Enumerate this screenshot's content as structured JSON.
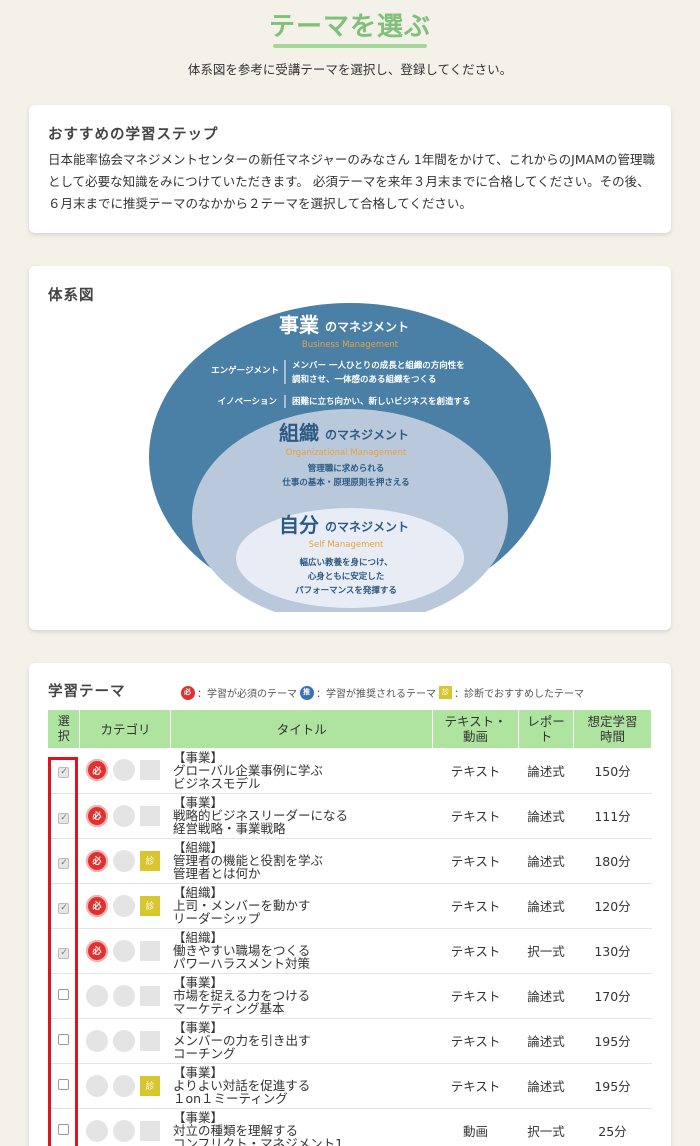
{
  "header": {
    "title": "テーマを選ぶ",
    "subtitle": "体系図を参考に受講テーマを選択し、登録してください。"
  },
  "recommend": {
    "heading": "おすすめの学習ステップ",
    "body": "日本能率協会マネジメントセンターの新任マネジャーのみなさん 1年間をかけて、これからのJMAMの管理職として必要な知識をみにつけていただきます。 必須テーマを来年３月末までに合格してください。その後、６月末までに推奨テーマのなかから２テーマを選択して合格してください。"
  },
  "system": {
    "heading": "体系図",
    "outer": {
      "title_big": "事業",
      "title_small": "のマネジメント",
      "english": "Business Management",
      "rows": [
        {
          "label": "エンゲージメント",
          "text1": "メンバー 一人ひとりの成長と組織の方向性を",
          "text2": "調和させ、一体感のある組織をつくる"
        },
        {
          "label": "イノベーション",
          "text1": "困難に立ち向かい、新しいビジネスを創造する",
          "text2": ""
        }
      ]
    },
    "middle": {
      "title_big": "組織",
      "title_small": "のマネジメント",
      "english": "Organizational Management",
      "line1": "管理職に求められる",
      "line2": "仕事の基本・原理原則を押さえる"
    },
    "inner": {
      "title_big": "自分",
      "title_small": "のマネジメント",
      "english": "Self Management",
      "line1": "幅広い教養を身につけ、",
      "line2": "心身ともに安定した",
      "line3": "パフォーマンスを発揮する"
    }
  },
  "themes": {
    "heading": "学習テーマ",
    "legend": {
      "required_mark": "必",
      "required_text": "：学習が必須のテーマ",
      "recommended_mark": "推",
      "recommended_text": "：学習が推奨されるテーマ",
      "diagnosis_mark": "診",
      "diagnosis_text": "：診断でおすすめしたテーマ"
    },
    "columns": {
      "select": "選択",
      "category": "カテゴリ",
      "title": "タイトル",
      "media": "テキスト・動画",
      "report": "レポート",
      "time": "想定学習時間"
    },
    "rows": [
      {
        "checked": true,
        "required": true,
        "diagnosis": false,
        "category": "【事業】",
        "line1": "グローバル企業事例に学ぶ",
        "line2": "ビジネスモデル",
        "media": "テキスト",
        "report": "論述式",
        "time": "150分"
      },
      {
        "checked": true,
        "required": true,
        "diagnosis": false,
        "category": "【事業】",
        "line1": "戦略的ビジネスリーダーになる",
        "line2": "経営戦略・事業戦略",
        "media": "テキスト",
        "report": "論述式",
        "time": "111分"
      },
      {
        "checked": true,
        "required": true,
        "diagnosis": true,
        "category": "【組織】",
        "line1": "管理者の機能と役割を学ぶ",
        "line2": "管理者とは何か",
        "media": "テキスト",
        "report": "論述式",
        "time": "180分"
      },
      {
        "checked": true,
        "required": true,
        "diagnosis": true,
        "category": "【組織】",
        "line1": "上司・メンバーを動かす",
        "line2": "リーダーシップ",
        "media": "テキスト",
        "report": "論述式",
        "time": "120分"
      },
      {
        "checked": true,
        "required": true,
        "diagnosis": false,
        "category": "【組織】",
        "line1": "働きやすい職場をつくる",
        "line2": "パワーハラスメント対策",
        "media": "テキスト",
        "report": "択一式",
        "time": "130分"
      },
      {
        "checked": false,
        "required": false,
        "diagnosis": false,
        "category": "【事業】",
        "line1": "市場を捉える力をつける",
        "line2": "マーケティング基本",
        "media": "テキスト",
        "report": "論述式",
        "time": "170分"
      },
      {
        "checked": false,
        "required": false,
        "diagnosis": false,
        "category": "【事業】",
        "line1": "メンバーの力を引き出す",
        "line2": "コーチング",
        "media": "テキスト",
        "report": "論述式",
        "time": "195分"
      },
      {
        "checked": false,
        "required": false,
        "diagnosis": true,
        "category": "【事業】",
        "line1": "よりよい対話を促進する",
        "line2": "１on１ミーティング",
        "media": "テキスト",
        "report": "論述式",
        "time": "195分"
      },
      {
        "checked": false,
        "required": false,
        "diagnosis": false,
        "category": "【事業】",
        "line1": "対立の種類を理解する",
        "line2": "コンフリクト・マネジメント1",
        "media": "動画",
        "report": "択一式",
        "time": "25分"
      }
    ]
  },
  "colors": {
    "accent_green": "#7fc07a",
    "header_green": "#aee3a0",
    "required_red": "#e03030",
    "recommended_blue": "#3b6fb6",
    "diagnosis_yellow": "#d8c62e",
    "diagram_outer": "#4a7fa6",
    "selection_frame": "#e0141c"
  }
}
